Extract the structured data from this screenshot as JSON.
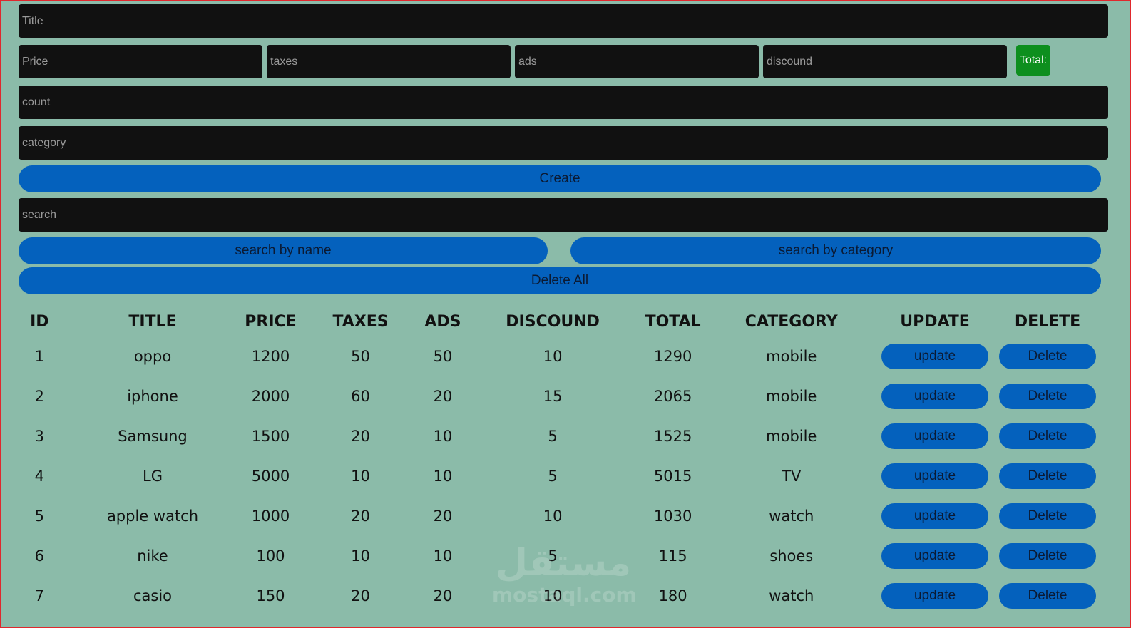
{
  "form": {
    "title_placeholder": "Title",
    "price_placeholder": "Price",
    "taxes_placeholder": "taxes",
    "ads_placeholder": "ads",
    "discount_placeholder": "discound",
    "total_label": "Total:",
    "count_placeholder": "count",
    "category_placeholder": "category",
    "create_label": "Create"
  },
  "search": {
    "placeholder": "search",
    "by_name_label": "search by name",
    "by_category_label": "search by category",
    "delete_all_label": "Delete All"
  },
  "table": {
    "columns": [
      "ID",
      "TITLE",
      "PRICE",
      "TAXES",
      "ADS",
      "DISCOUND",
      "TOTAL",
      "CATEGORY",
      "UPDATE",
      "DELETE"
    ],
    "update_label": "update",
    "delete_label": "Delete",
    "rows": [
      {
        "id": "1",
        "title": "oppo",
        "price": "1200",
        "taxes": "50",
        "ads": "50",
        "discount": "10",
        "total": "1290",
        "category": "mobile"
      },
      {
        "id": "2",
        "title": "iphone",
        "price": "2000",
        "taxes": "60",
        "ads": "20",
        "discount": "15",
        "total": "2065",
        "category": "mobile"
      },
      {
        "id": "3",
        "title": "Samsung",
        "price": "1500",
        "taxes": "20",
        "ads": "10",
        "discount": "5",
        "total": "1525",
        "category": "mobile"
      },
      {
        "id": "4",
        "title": "LG",
        "price": "5000",
        "taxes": "10",
        "ads": "10",
        "discount": "5",
        "total": "5015",
        "category": "TV"
      },
      {
        "id": "5",
        "title": "apple watch",
        "price": "1000",
        "taxes": "20",
        "ads": "20",
        "discount": "10",
        "total": "1030",
        "category": "watch"
      },
      {
        "id": "6",
        "title": "nike",
        "price": "100",
        "taxes": "10",
        "ads": "10",
        "discount": "5",
        "total": "115",
        "category": "shoes"
      },
      {
        "id": "7",
        "title": "casio",
        "price": "150",
        "taxes": "20",
        "ads": "20",
        "discount": "10",
        "total": "180",
        "category": "watch"
      }
    ]
  },
  "watermark": {
    "arabic": "مستقل",
    "latin": "mostaql.com"
  },
  "colors": {
    "background": "#8bbba9",
    "input_bg": "#111111",
    "button_blue": "#0461bd",
    "total_green": "#0d8f1e",
    "frame_red": "#e0282d"
  }
}
